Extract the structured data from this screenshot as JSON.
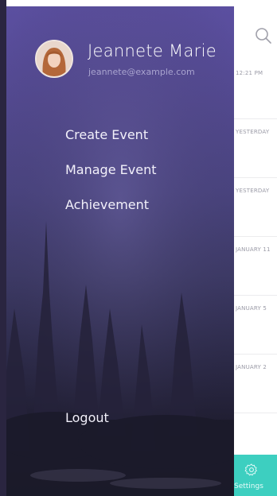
{
  "list": {
    "rows": [
      {
        "time": "12:21 PM"
      },
      {
        "time": "YESTERDAY"
      },
      {
        "time": "YESTERDAY"
      },
      {
        "time": "JANUARY 11"
      },
      {
        "time": "JANUARY 5"
      },
      {
        "time": "JANUARY 2"
      }
    ],
    "search_icon": "search-icon"
  },
  "settings": {
    "label": "Settings",
    "icon": "gear-icon",
    "color": "#3dcfc0"
  },
  "drawer": {
    "user": {
      "name": "Jeannete Marie",
      "email": "jeannete@example.com"
    },
    "menu": [
      {
        "label": "Create Event"
      },
      {
        "label": "Manage Event"
      },
      {
        "label": "Achievement"
      }
    ],
    "logout_label": "Logout",
    "accent": "#5b4fa0"
  }
}
